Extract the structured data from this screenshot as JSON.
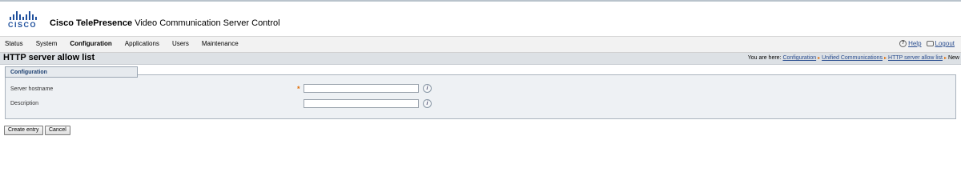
{
  "header": {
    "logo_text": "CISCO",
    "title_bold": "Cisco TelePresence",
    "title_rest": " Video Communication Server Control"
  },
  "nav": {
    "items": [
      {
        "label": "Status",
        "active": false
      },
      {
        "label": "System",
        "active": false
      },
      {
        "label": "Configuration",
        "active": true
      },
      {
        "label": "Applications",
        "active": false
      },
      {
        "label": "Users",
        "active": false
      },
      {
        "label": "Maintenance",
        "active": false
      }
    ],
    "help_label": "Help",
    "logout_label": "Logout",
    "help_icon": "?"
  },
  "titlebar": {
    "page_title": "HTTP server allow list",
    "breadcrumb_prefix": "You are here:",
    "breadcrumb_links": [
      "Configuration",
      "Unified Communications",
      "HTTP server allow list"
    ],
    "breadcrumb_current": "New",
    "separator": "▸"
  },
  "panel": {
    "title": "Configuration",
    "fields": [
      {
        "label": "Server hostname",
        "value": "",
        "required": true
      },
      {
        "label": "Description",
        "value": "",
        "required": false
      }
    ],
    "required_mark": "*",
    "info_icon": "i"
  },
  "buttons": {
    "create_label": "Create entry",
    "cancel_label": "Cancel"
  },
  "colors": {
    "brand": "#1e4f9c",
    "link": "#2a4d8f",
    "required": "#e06a00",
    "panel_bg": "#eef1f4"
  }
}
